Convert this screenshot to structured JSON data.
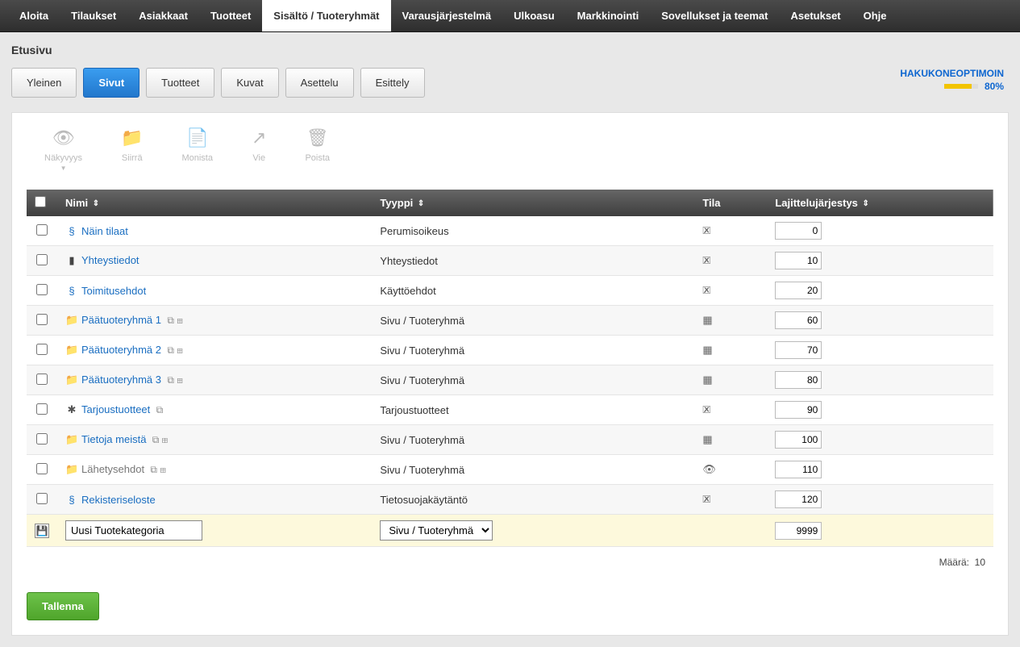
{
  "topnav": {
    "items": [
      {
        "label": "Aloita"
      },
      {
        "label": "Tilaukset"
      },
      {
        "label": "Asiakkaat"
      },
      {
        "label": "Tuotteet"
      },
      {
        "label": "Sisältö / Tuoteryhmät",
        "active": true
      },
      {
        "label": "Varausjärjestelmä"
      },
      {
        "label": "Ulkoasu"
      },
      {
        "label": "Markkinointi"
      },
      {
        "label": "Sovellukset ja teemat"
      },
      {
        "label": "Asetukset"
      },
      {
        "label": "Ohje"
      }
    ]
  },
  "page_title": "Etusivu",
  "subtabs": [
    {
      "label": "Yleinen"
    },
    {
      "label": "Sivut",
      "active": true
    },
    {
      "label": "Tuotteet"
    },
    {
      "label": "Kuvat"
    },
    {
      "label": "Asettelu"
    },
    {
      "label": "Esittely"
    }
  ],
  "seo": {
    "label": "HAKUKONEOPTIMOIN",
    "percent": "80%"
  },
  "toolbar": [
    {
      "label": "Näkyvyys",
      "glyph": "👁",
      "caret": true
    },
    {
      "label": "Siirrä",
      "glyph": "📁"
    },
    {
      "label": "Monista",
      "glyph": "📄"
    },
    {
      "label": "Vie",
      "glyph": "↗"
    },
    {
      "label": "Poista",
      "glyph": "🗑"
    }
  ],
  "table": {
    "headers": {
      "name": "Nimi",
      "type": "Tyyppi",
      "status": "Tila",
      "sort": "Lajittelujärjestys"
    },
    "rows": [
      {
        "icon": "§",
        "name": "Näin tilaat",
        "type": "Perumisoikeus",
        "status": "blocked",
        "sort": "0",
        "link": true,
        "color": "#1a6ec1",
        "iconColor": "#1a6ec1"
      },
      {
        "icon": "▮",
        "name": "Yhteystiedot",
        "type": "Yhteystiedot",
        "status": "blocked",
        "sort": "10",
        "link": true,
        "color": "#1a6ec1",
        "iconColor": "#444"
      },
      {
        "icon": "§",
        "name": "Toimitusehdot",
        "type": "Käyttöehdot",
        "status": "blocked",
        "sort": "20",
        "link": true,
        "color": "#1a6ec1",
        "iconColor": "#1a6ec1"
      },
      {
        "icon": "📁",
        "name": "Päätuoteryhmä 1",
        "type": "Sivu / Tuoteryhmä",
        "status": "grid",
        "sort": "60",
        "link": true,
        "after": "⧉ ⊞",
        "color": "#1a6ec1",
        "iconColor": "#555"
      },
      {
        "icon": "📁",
        "name": "Päätuoteryhmä 2",
        "type": "Sivu / Tuoteryhmä",
        "status": "grid",
        "sort": "70",
        "link": true,
        "after": "⧉ ⊞",
        "color": "#1a6ec1",
        "iconColor": "#555"
      },
      {
        "icon": "📁",
        "name": "Päätuoteryhmä 3",
        "type": "Sivu / Tuoteryhmä",
        "status": "grid",
        "sort": "80",
        "link": true,
        "after": "⧉ ⊞",
        "color": "#1a6ec1",
        "iconColor": "#555"
      },
      {
        "icon": "✱",
        "name": "Tarjoustuotteet",
        "type": "Tarjoustuotteet",
        "status": "blocked",
        "sort": "90",
        "link": true,
        "after": "⧉",
        "color": "#1a6ec1",
        "iconColor": "#555"
      },
      {
        "icon": "📁",
        "name": "Tietoja meistä",
        "type": "Sivu / Tuoteryhmä",
        "status": "grid",
        "sort": "100",
        "link": true,
        "after": "⧉ ⊞",
        "color": "#1a6ec1",
        "iconColor": "#555"
      },
      {
        "icon": "📁",
        "name": "Lähetysehdot",
        "type": "Sivu / Tuoteryhmä",
        "status": "eye-off",
        "sort": "110",
        "link": false,
        "after": "⧉ ⊞",
        "color": "#777",
        "iconColor": "#999"
      },
      {
        "icon": "§",
        "name": "Rekisteriseloste",
        "type": "Tietosuojakäytäntö",
        "status": "blocked",
        "sort": "120",
        "link": true,
        "color": "#1a6ec1",
        "iconColor": "#1a6ec1"
      }
    ],
    "new_row": {
      "name_value": "Uusi Tuotekategoria",
      "type_value": "Sivu / Tuoteryhmä",
      "sort_value": "9999"
    },
    "footer": {
      "label": "Määrä:",
      "count": "10"
    }
  },
  "save_label": "Tallenna",
  "status_glyphs": {
    "blocked": "🗷",
    "grid": "▦",
    "eye-off": "👁"
  }
}
